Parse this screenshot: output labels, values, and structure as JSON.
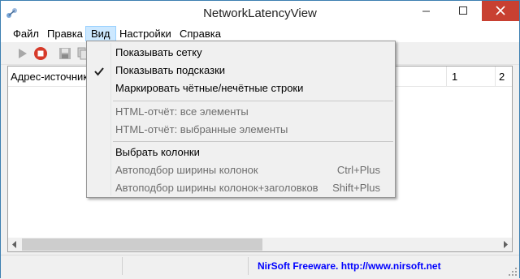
{
  "window": {
    "title": "NetworkLatencyView"
  },
  "menubar": {
    "items": [
      {
        "label": "Файл"
      },
      {
        "label": "Правка"
      },
      {
        "label": "Вид"
      },
      {
        "label": "Настройки"
      },
      {
        "label": "Справка"
      }
    ]
  },
  "listview": {
    "columns": [
      {
        "label": "Адрес-источник"
      },
      {
        "label": "1"
      },
      {
        "label": "2"
      }
    ]
  },
  "dropdown": {
    "items": [
      {
        "label": "Показывать сетку",
        "checked": false,
        "disabled": false
      },
      {
        "label": "Показывать подсказки",
        "checked": true,
        "disabled": false
      },
      {
        "label": "Маркировать чётные/нечётные строки",
        "checked": false,
        "disabled": false
      },
      {
        "label": "HTML-отчёт: все элементы",
        "checked": false,
        "disabled": true
      },
      {
        "label": "HTML-отчёт: выбранные элементы",
        "checked": false,
        "disabled": true
      },
      {
        "label": "Выбрать колонки",
        "checked": false,
        "disabled": false
      },
      {
        "label": "Автоподбор ширины колонок",
        "shortcut": "Ctrl+Plus",
        "checked": false,
        "disabled": true
      },
      {
        "label": "Автоподбор ширины колонок+заголовков",
        "shortcut": "Shift+Plus",
        "checked": false,
        "disabled": true
      }
    ]
  },
  "statusbar": {
    "link_text": "NirSoft Freeware.  http://www.nirsoft.net"
  },
  "colors": {
    "close_button": "#c84031",
    "menu_highlight": "#cce8ff",
    "dropdown_hover": "#91c9f7",
    "link": "#0000ff"
  }
}
